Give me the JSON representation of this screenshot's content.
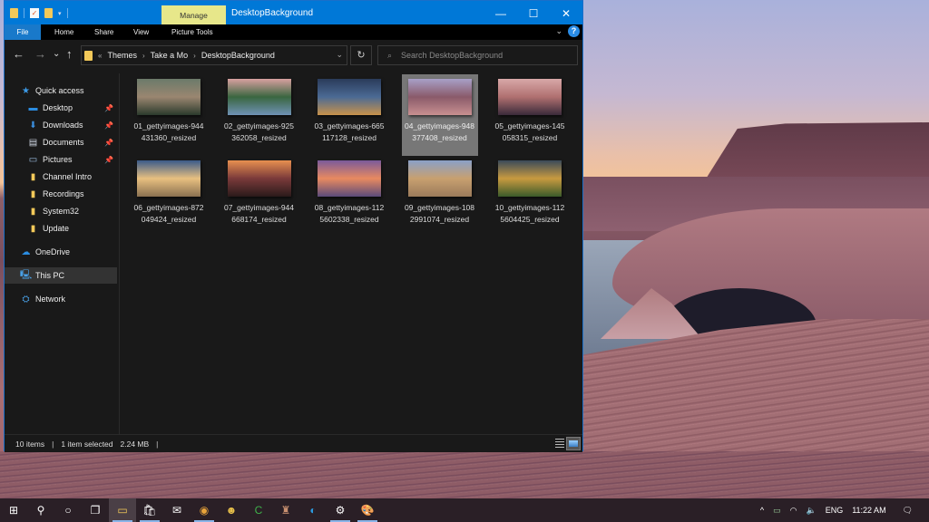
{
  "window": {
    "title": "DesktopBackground",
    "context_tab": "Manage",
    "controls": {
      "minimize": "—",
      "maximize": "☐",
      "close": "✕"
    }
  },
  "ribbon": {
    "tabs": [
      "File",
      "Home",
      "Share",
      "View",
      "Picture Tools"
    ],
    "collapse_icon": "⌄",
    "help_icon": "?"
  },
  "navigation": {
    "back": "←",
    "forward": "→",
    "recent": "⌄",
    "up": "↑",
    "breadcrumb": [
      "«",
      "Themes",
      "Take a Mo",
      "DesktopBackground"
    ],
    "breadcrumb_sep": "›",
    "address_dropdown": "⌄",
    "refresh": "↻",
    "search_placeholder": "Search DesktopBackground",
    "search_icon": "⌕"
  },
  "sidebar": {
    "items": [
      {
        "label": "Quick access",
        "icon": "star-icon",
        "glyph": "★",
        "color": "#3c9be8"
      },
      {
        "label": "Desktop",
        "icon": "desktop-icon",
        "glyph": "▬",
        "color": "#2b8ce0",
        "pinned": true
      },
      {
        "label": "Downloads",
        "icon": "download-icon",
        "glyph": "⬇",
        "color": "#3b8fe0",
        "pinned": true
      },
      {
        "label": "Documents",
        "icon": "documents-icon",
        "glyph": "▤",
        "color": "#cfd6e2",
        "pinned": true
      },
      {
        "label": "Pictures",
        "icon": "pictures-icon",
        "glyph": "▭",
        "color": "#9fc3e6",
        "pinned": true
      },
      {
        "label": "Channel Intro",
        "icon": "folder-icon",
        "glyph": "▮",
        "color": "#f3c959"
      },
      {
        "label": "Recordings",
        "icon": "folder-icon",
        "glyph": "▮",
        "color": "#f3c959"
      },
      {
        "label": "System32",
        "icon": "folder-icon",
        "glyph": "▮",
        "color": "#f3c959"
      },
      {
        "label": "Update",
        "icon": "folder-icon",
        "glyph": "▮",
        "color": "#f3c959"
      },
      {
        "label": "OneDrive",
        "icon": "cloud-icon",
        "glyph": "☁",
        "color": "#2b8ce0"
      },
      {
        "label": "This PC",
        "icon": "computer-icon",
        "glyph": "🖳",
        "color": "#4aa3ea",
        "selected": true
      },
      {
        "label": "Network",
        "icon": "network-icon",
        "glyph": "⛭",
        "color": "#4aa3ea"
      }
    ],
    "pin_glyph": "📌"
  },
  "files": [
    {
      "name": "01_gettyimages-944431360_resized",
      "colors": [
        "#6b7a6a",
        "#9a8670",
        "#2b3a2c"
      ]
    },
    {
      "name": "02_gettyimages-925362058_resized",
      "colors": [
        "#d8a0a0",
        "#3a6640",
        "#6f92b5"
      ]
    },
    {
      "name": "03_gettyimages-665117128_resized",
      "colors": [
        "#2a3b5a",
        "#4b6a94",
        "#c8924a"
      ]
    },
    {
      "name": "04_gettyimages-948377408_resized",
      "colors": [
        "#a8a0c8",
        "#8a5a6a",
        "#c89090"
      ],
      "selected": true
    },
    {
      "name": "05_gettyimages-145058315_resized",
      "colors": [
        "#d8a8a8",
        "#b07070",
        "#3a2a3a"
      ]
    },
    {
      "name": "06_gettyimages-872049424_resized",
      "colors": [
        "#3a5a8a",
        "#e8c080",
        "#8a7050"
      ]
    },
    {
      "name": "07_gettyimages-944668174_resized",
      "colors": [
        "#e89050",
        "#7a3a3a",
        "#2a1a1a"
      ]
    },
    {
      "name": "08_gettyimages-1125602338_resized",
      "colors": [
        "#7a5a9a",
        "#e88a60",
        "#5a4a7a"
      ]
    },
    {
      "name": "09_gettyimages-1082991074_resized",
      "colors": [
        "#8aa0c8",
        "#c8a070",
        "#9a7a5a"
      ]
    },
    {
      "name": "10_gettyimages-1125604425_resized",
      "colors": [
        "#3a4a5a",
        "#c89a40",
        "#3a5a2a"
      ]
    }
  ],
  "status": {
    "item_count": "10 items",
    "selection": "1 item selected",
    "size": "2.24 MB",
    "sep": "|"
  },
  "taskbar": {
    "items": [
      {
        "name": "start-button",
        "glyph": "⊞"
      },
      {
        "name": "search-button",
        "glyph": "⚲"
      },
      {
        "name": "cortana-button",
        "glyph": "○"
      },
      {
        "name": "task-view-button",
        "glyph": "❐"
      },
      {
        "name": "file-explorer-button",
        "glyph": "▭",
        "color": "#f3c959",
        "active": true,
        "running": true
      },
      {
        "name": "store-button",
        "glyph": "🛍",
        "running": true
      },
      {
        "name": "mail-button",
        "glyph": "✉"
      },
      {
        "name": "chrome-button",
        "glyph": "◉",
        "color": "#e8a33a",
        "running": true
      },
      {
        "name": "app-button",
        "glyph": "☻",
        "color": "#e8c04a"
      },
      {
        "name": "camtasia-button",
        "glyph": "C",
        "color": "#3fb04a"
      },
      {
        "name": "app-button-2",
        "glyph": "♜",
        "color": "#c89070"
      },
      {
        "name": "edge-button",
        "glyph": "◐",
        "color": "#2b9ae0"
      },
      {
        "name": "settings-button",
        "glyph": "⚙",
        "running": true
      },
      {
        "name": "paint-button",
        "glyph": "🎨",
        "running": true
      }
    ],
    "tray": {
      "chevron": "^",
      "battery": "▭",
      "wifi": "◠",
      "volume": "🔈",
      "language": "ENG",
      "time": "11:22 AM",
      "notifications": "🗨"
    }
  }
}
